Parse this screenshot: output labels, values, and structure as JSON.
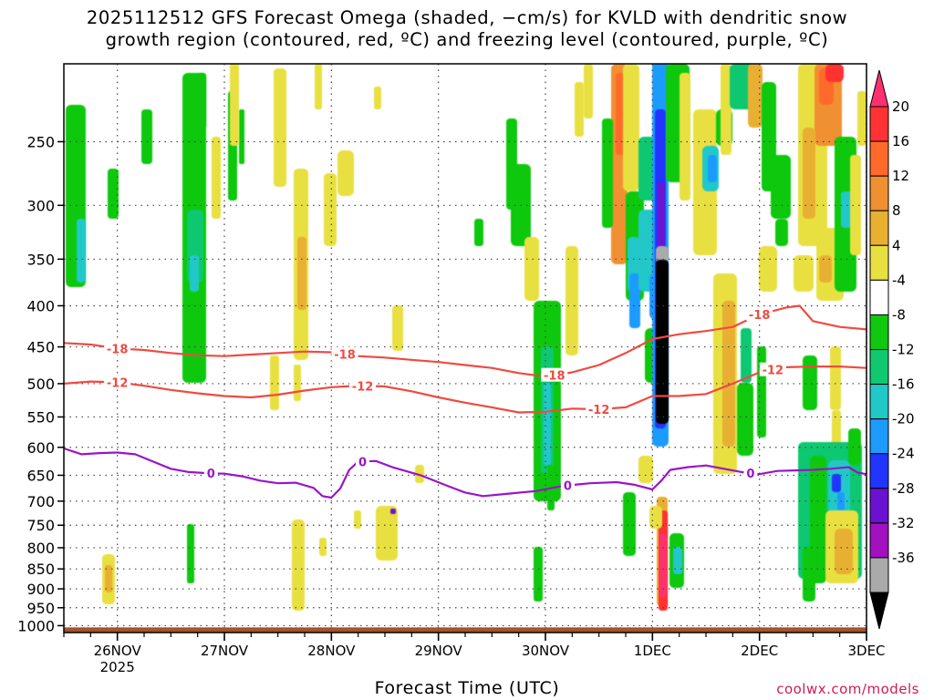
{
  "title_line1": "2025112512 GFS Forecast Omega (shaded, −cm/s) for KVLD with dendritic snow",
  "title_line2": "growth region (contoured, red, ºC) and freezing level (contoured, purple, ºC)",
  "x_title": "Forecast Time (UTC)",
  "credit": "coolwx.com/models",
  "colors": {
    "dgz_contour": "#f04a40",
    "freezing_contour": "#9b14c8",
    "ground": "#a5532b",
    "grid": "#444444"
  },
  "chart_data": {
    "type": "heatmap",
    "y_axis": {
      "label": "",
      "scale": "log",
      "ticks": [
        250,
        300,
        350,
        400,
        450,
        500,
        550,
        600,
        650,
        700,
        750,
        800,
        850,
        900,
        950,
        1000
      ],
      "ylim_hPa": [
        200,
        1020
      ],
      "inverted": true
    },
    "x_axis": {
      "tick_labels": [
        "26NOV",
        "27NOV",
        "28NOV",
        "29NOV",
        "30NOV",
        "1DEC",
        "2DEC",
        "3DEC"
      ],
      "tick_hours": [
        12,
        36,
        60,
        84,
        108,
        132,
        156,
        180
      ],
      "year_label": "2025",
      "xlim_hours": [
        0,
        180
      ]
    },
    "colorbar": {
      "labels": [
        "20",
        "16",
        "12",
        "8",
        "4",
        "-4",
        "-8",
        "-12",
        "-16",
        "-20",
        "-24",
        "-28",
        "-32",
        "-36"
      ],
      "colors": [
        "#ff3070",
        "#ff3333",
        "#ff6a2a",
        "#f09030",
        "#e8b030",
        "#e8e040",
        "#ffffff",
        "#10c810",
        "#10c870",
        "#20c8c8",
        "#1d9bff",
        "#2035ff",
        "#6a12d0",
        "#a210c0",
        "#aaaaaa",
        "#000000"
      ]
    },
    "contours": [
      {
        "level": "-18",
        "color": "red",
        "points": [
          [
            0,
            445
          ],
          [
            6,
            447
          ],
          [
            12,
            452
          ],
          [
            18,
            454
          ],
          [
            24,
            458
          ],
          [
            30,
            461
          ],
          [
            36,
            462
          ],
          [
            42,
            460
          ],
          [
            48,
            458
          ],
          [
            54,
            456
          ],
          [
            60,
            457
          ],
          [
            66,
            462
          ],
          [
            72,
            464
          ],
          [
            78,
            467
          ],
          [
            84,
            470
          ],
          [
            90,
            474
          ],
          [
            96,
            478
          ],
          [
            102,
            485
          ],
          [
            108,
            490
          ],
          [
            114,
            484
          ],
          [
            120,
            474
          ],
          [
            126,
            458
          ],
          [
            132,
            440
          ],
          [
            138,
            434
          ],
          [
            144,
            430
          ],
          [
            150,
            425
          ],
          [
            156,
            410
          ],
          [
            162,
            402
          ],
          [
            165,
            400
          ],
          [
            168,
            418
          ],
          [
            174,
            425
          ],
          [
            180,
            428
          ]
        ],
        "label_at_hours": [
          12,
          63,
          110,
          156
        ]
      },
      {
        "level": "-12",
        "color": "red",
        "points": [
          [
            0,
            500
          ],
          [
            6,
            497
          ],
          [
            12,
            498
          ],
          [
            18,
            503
          ],
          [
            24,
            509
          ],
          [
            30,
            514
          ],
          [
            36,
            518
          ],
          [
            42,
            520
          ],
          [
            48,
            516
          ],
          [
            54,
            510
          ],
          [
            60,
            505
          ],
          [
            66,
            503
          ],
          [
            72,
            504
          ],
          [
            78,
            511
          ],
          [
            84,
            520
          ],
          [
            90,
            528
          ],
          [
            96,
            535
          ],
          [
            102,
            543
          ],
          [
            108,
            542
          ],
          [
            114,
            537
          ],
          [
            120,
            538
          ],
          [
            126,
            535
          ],
          [
            132,
            518
          ],
          [
            138,
            518
          ],
          [
            144,
            515
          ],
          [
            150,
            500
          ],
          [
            156,
            484
          ],
          [
            162,
            477
          ],
          [
            168,
            476
          ],
          [
            174,
            476
          ],
          [
            180,
            478
          ]
        ],
        "label_at_hours": [
          12,
          67,
          120,
          159
        ]
      },
      {
        "level": "0",
        "color": "purple",
        "points": [
          [
            0,
            602
          ],
          [
            4,
            612
          ],
          [
            8,
            610
          ],
          [
            12,
            609
          ],
          [
            16,
            612
          ],
          [
            20,
            625
          ],
          [
            24,
            638
          ],
          [
            28,
            644
          ],
          [
            32,
            646
          ],
          [
            36,
            647
          ],
          [
            40,
            652
          ],
          [
            44,
            660
          ],
          [
            48,
            665
          ],
          [
            52,
            664
          ],
          [
            56,
            674
          ],
          [
            58,
            690
          ],
          [
            60,
            693
          ],
          [
            62,
            675
          ],
          [
            64,
            640
          ],
          [
            66,
            625
          ],
          [
            70,
            624
          ],
          [
            74,
            636
          ],
          [
            80,
            650
          ],
          [
            86,
            670
          ],
          [
            90,
            683
          ],
          [
            94,
            690
          ],
          [
            100,
            685
          ],
          [
            106,
            680
          ],
          [
            112,
            670
          ],
          [
            118,
            665
          ],
          [
            124,
            663
          ],
          [
            128,
            668
          ],
          [
            132,
            677
          ],
          [
            134,
            660
          ],
          [
            136,
            640
          ],
          [
            140,
            635
          ],
          [
            144,
            632
          ],
          [
            148,
            638
          ],
          [
            152,
            644
          ],
          [
            156,
            648
          ],
          [
            160,
            642
          ],
          [
            164,
            641
          ],
          [
            168,
            640
          ],
          [
            172,
            638
          ],
          [
            176,
            635
          ],
          [
            178,
            645
          ],
          [
            180,
            648
          ]
        ],
        "label_at_hours": [
          33,
          67,
          113,
          154
        ]
      }
    ]
  }
}
